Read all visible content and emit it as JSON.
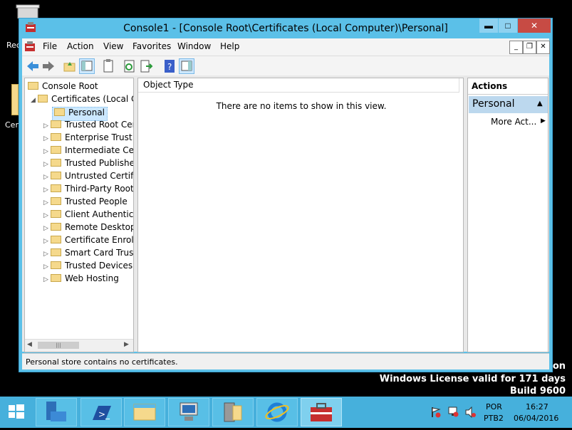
{
  "desktop": {
    "recycle_bin_label": "Rec",
    "cert_icon_label": "Cer",
    "watermark": {
      "line1": "on",
      "line2": "Windows License valid for 171 days",
      "line3": "Build 9600"
    }
  },
  "window": {
    "title": "Console1 - [Console Root\\Certificates (Local Computer)\\Personal]",
    "minimize": "▬",
    "maximize": "□",
    "close": "✕"
  },
  "menubar": {
    "items": [
      "File",
      "Action",
      "View",
      "Favorites",
      "Window",
      "Help"
    ],
    "mdi_min": "_",
    "mdi_restore": "❐",
    "mdi_close": "✕"
  },
  "tree": {
    "root": "Console Root",
    "certs": "Certificates (Local Co",
    "personal": "Personal",
    "stores": [
      "Trusted Root Cer",
      "Enterprise Trust",
      "Intermediate Cert",
      "Trusted Publisher",
      "Untrusted Certific",
      "Third-Party Root",
      "Trusted People",
      "Client Authentica",
      "Remote Desktop",
      "Certificate Enrolln",
      "Smart Card Trust",
      "Trusted Devices",
      "Web Hosting"
    ]
  },
  "center": {
    "column_header": "Object Type",
    "empty_message": "There are no items to show in this view."
  },
  "actions": {
    "header": "Actions",
    "section": "Personal",
    "more": "More Act..."
  },
  "statusbar": {
    "text": "Personal store contains no certificates."
  },
  "taskbar": {
    "lang1": "POR",
    "lang2": "PTB2",
    "time": "16:27",
    "date": "06/04/2016"
  },
  "colors": {
    "window_frame": "#5bc0e8",
    "close_button": "#c74b44",
    "taskbar": "#46b0dc",
    "selection": "#cce8ff"
  }
}
